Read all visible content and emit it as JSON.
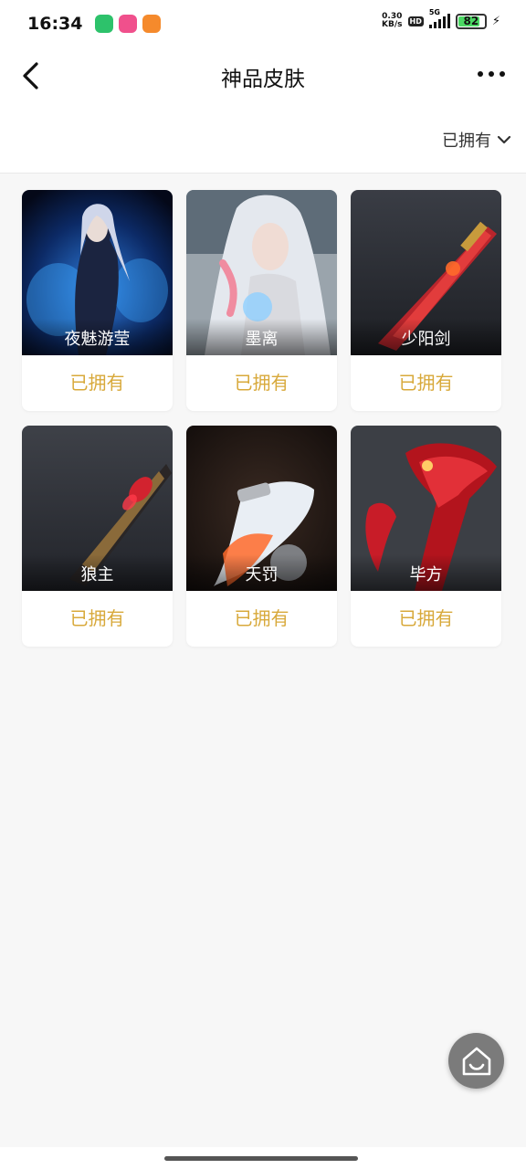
{
  "status_bar": {
    "time": "16:34",
    "network_speed_value": "0.30",
    "network_speed_unit": "KB/s",
    "hd_label": "HD",
    "signal_label": "5G",
    "battery": "82"
  },
  "header": {
    "title": "神品皮肤"
  },
  "filter": {
    "label": "已拥有"
  },
  "items": [
    {
      "name": "夜魅游莹",
      "status": "已拥有"
    },
    {
      "name": "墨离",
      "status": "已拥有"
    },
    {
      "name": "少阳剑",
      "status": "已拥有"
    },
    {
      "name": "狼主",
      "status": "已拥有"
    },
    {
      "name": "天罚",
      "status": "已拥有"
    },
    {
      "name": "毕方",
      "status": "已拥有"
    }
  ],
  "colors": {
    "owned_text": "#d8a93b",
    "background": "#f7f7f7"
  }
}
